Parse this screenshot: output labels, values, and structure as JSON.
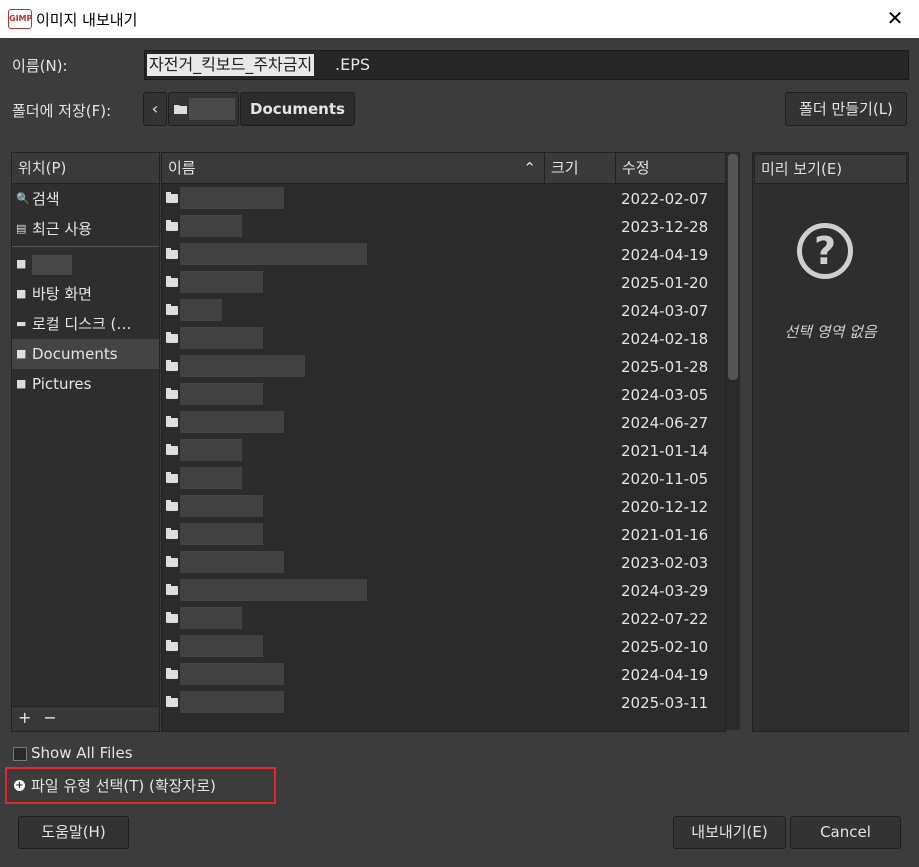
{
  "window": {
    "title": "이미지 내보내기",
    "app_icon": "GIMP",
    "close_glyph": "✕"
  },
  "name_row": {
    "label": "이름(N):",
    "filename_selected": "자전거_킥보드_주차금지",
    "filename_ext": ".EPS"
  },
  "folder_row": {
    "label": "폴더에 저장(F):",
    "back_glyph": "‹",
    "current": "Documents",
    "create_folder": "폴더 만들기(L)"
  },
  "places": {
    "header": "위치(P)",
    "items": [
      {
        "label": "검색",
        "icon": "search-icon"
      },
      {
        "label": "최근 사용",
        "icon": "recent-icon"
      }
    ],
    "items2": [
      {
        "label": "바탕 화면",
        "icon": "folder-icon"
      },
      {
        "label": "로컬 디스크 (…",
        "icon": "drive-icon"
      },
      {
        "label": "Documents",
        "icon": "folder-icon"
      },
      {
        "label": "Pictures",
        "icon": "folder-icon"
      }
    ],
    "add_glyph": "+",
    "remove_glyph": "−"
  },
  "files": {
    "columns": {
      "name": "이름",
      "size": "크기",
      "modified": "수정"
    },
    "sort_glyph": "⌃",
    "rows": [
      {
        "date": "2022-02-07"
      },
      {
        "date": "2023-12-28"
      },
      {
        "date": "2024-04-19"
      },
      {
        "date": "2025-01-20"
      },
      {
        "date": "2024-03-07"
      },
      {
        "date": "2024-02-18"
      },
      {
        "date": "2025-01-28"
      },
      {
        "date": "2024-03-05"
      },
      {
        "date": "2024-06-27"
      },
      {
        "date": "2021-01-14"
      },
      {
        "date": "2020-11-05"
      },
      {
        "date": "2020-12-12"
      },
      {
        "date": "2021-01-16"
      },
      {
        "date": "2023-02-03"
      },
      {
        "date": "2024-03-29"
      },
      {
        "date": "2022-07-22"
      },
      {
        "date": "2025-02-10"
      },
      {
        "date": "2024-04-19"
      },
      {
        "date": "2025-03-11"
      }
    ]
  },
  "preview": {
    "header": "미리 보기(E)",
    "glyph": "?",
    "empty_text": "선택 영역 없음"
  },
  "show_all_files": {
    "label": "Show All Files",
    "checked": false
  },
  "file_type": {
    "label": "파일 유형 선택(T) (확장자로)",
    "glyph": "+"
  },
  "buttons": {
    "help": "도움말(H)",
    "export": "내보내기(E)",
    "cancel": "Cancel"
  }
}
